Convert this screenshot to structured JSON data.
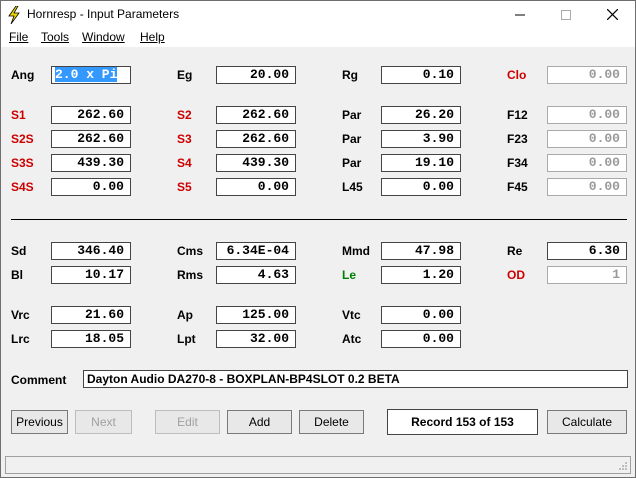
{
  "window": {
    "title": "Hornresp - Input Parameters",
    "minimize_icon": "minimize-icon",
    "maximize_icon": "maximize-icon",
    "close_icon": "close-icon"
  },
  "menu": [
    "File",
    "Tools",
    "Window",
    "Help"
  ],
  "params": {
    "Ang": {
      "label": "Ang",
      "value": "2.0 x Pi"
    },
    "Eg": {
      "label": "Eg",
      "value": "20.00"
    },
    "Rg": {
      "label": "Rg",
      "value": "0.10"
    },
    "Clo": {
      "label": "Clo",
      "value": "0.00"
    },
    "S1": {
      "label": "S1",
      "value": "262.60"
    },
    "S2": {
      "label": "S2",
      "value": "262.60"
    },
    "Par1": {
      "label": "Par",
      "value": "26.20"
    },
    "F12": {
      "label": "F12",
      "value": "0.00"
    },
    "S2S": {
      "label": "S2S",
      "value": "262.60"
    },
    "S3": {
      "label": "S3",
      "value": "262.60"
    },
    "Par2": {
      "label": "Par",
      "value": "3.90"
    },
    "F23": {
      "label": "F23",
      "value": "0.00"
    },
    "S3S": {
      "label": "S3S",
      "value": "439.30"
    },
    "S4": {
      "label": "S4",
      "value": "439.30"
    },
    "Par3": {
      "label": "Par",
      "value": "19.10"
    },
    "F34": {
      "label": "F34",
      "value": "0.00"
    },
    "S4S": {
      "label": "S4S",
      "value": "0.00"
    },
    "S5": {
      "label": "S5",
      "value": "0.00"
    },
    "L45": {
      "label": "L45",
      "value": "0.00"
    },
    "F45": {
      "label": "F45",
      "value": "0.00"
    },
    "Sd": {
      "label": "Sd",
      "value": "346.40"
    },
    "Cms": {
      "label": "Cms",
      "value": "6.34E-04"
    },
    "Mmd": {
      "label": "Mmd",
      "value": "47.98"
    },
    "Re": {
      "label": "Re",
      "value": "6.30"
    },
    "Bl": {
      "label": "Bl",
      "value": "10.17"
    },
    "Rms": {
      "label": "Rms",
      "value": "4.63"
    },
    "Le": {
      "label": "Le",
      "value": "1.20"
    },
    "OD": {
      "label": "OD",
      "value": "1"
    },
    "Vrc": {
      "label": "Vrc",
      "value": "21.60"
    },
    "Ap": {
      "label": "Ap",
      "value": "125.00"
    },
    "Vtc": {
      "label": "Vtc",
      "value": "0.00"
    },
    "Lrc": {
      "label": "Lrc",
      "value": "18.05"
    },
    "Lpt": {
      "label": "Lpt",
      "value": "32.00"
    },
    "Atc": {
      "label": "Atc",
      "value": "0.00"
    }
  },
  "comment": {
    "label": "Comment",
    "value": "Dayton Audio DA270-8 - BOXPLAN-BP4SLOT 0.2 BETA"
  },
  "buttons": {
    "previous": "Previous",
    "next": "Next",
    "edit": "Edit",
    "add": "Add",
    "delete": "Delete",
    "calculate": "Calculate"
  },
  "record": "Record 153 of 153",
  "colors": {
    "red_label": "#cc0000",
    "green_label": "#008000",
    "selection": "#3399ff"
  }
}
